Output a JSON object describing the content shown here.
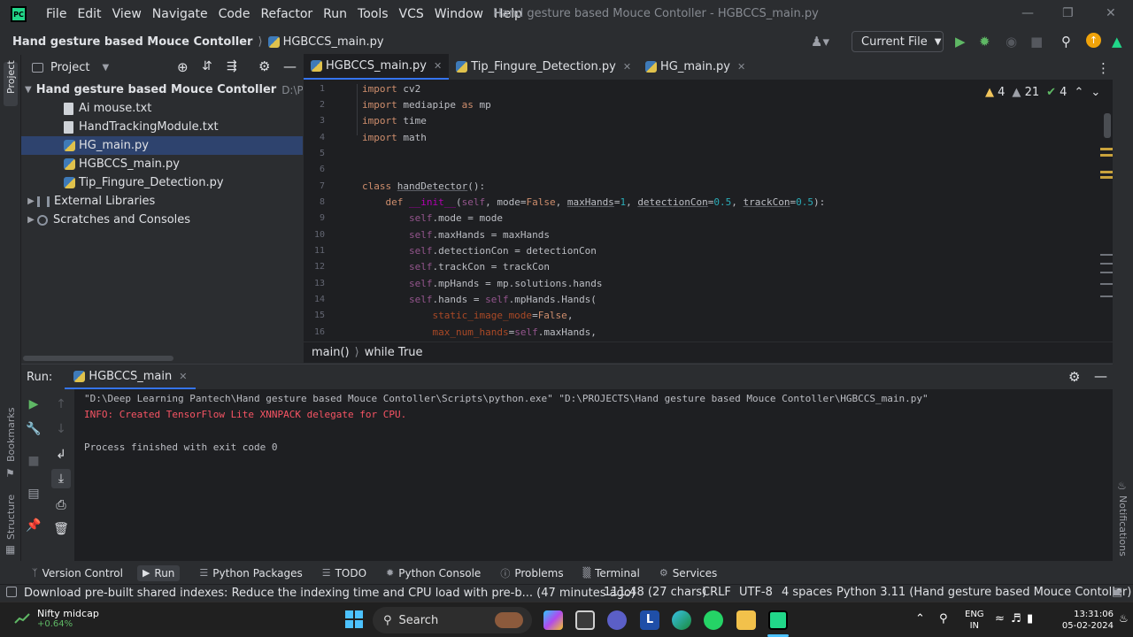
{
  "app": {
    "logo_text": "PC",
    "menu": [
      "File",
      "Edit",
      "View",
      "Navigate",
      "Code",
      "Refactor",
      "Run",
      "Tools",
      "VCS",
      "Window",
      "Help"
    ],
    "window_title": "Hand gesture based Mouce Contoller - HGBCCS_main.py"
  },
  "navbar": {
    "project": "Hand gesture based Mouce Contoller",
    "file": "HGBCCS_main.py",
    "run_config": "Current File"
  },
  "project_panel": {
    "title": "Project",
    "stripe_label": "Project",
    "root_name": "Hand gesture based Mouce Contoller",
    "root_path": "D:\\PRO",
    "files": [
      "Ai mouse.txt",
      "HandTrackingModule.txt",
      "HG_main.py",
      "HGBCCS_main.py",
      "Tip_Fingure_Detection.py"
    ],
    "external": "External Libraries",
    "scratches": "Scratches and Consoles"
  },
  "editor": {
    "tabs": [
      "HGBCCS_main.py",
      "Tip_Fingure_Detection.py",
      "HG_main.py"
    ],
    "line_numbers": [
      "1",
      "2",
      "3",
      "4",
      "5",
      "6",
      "7",
      "8",
      "9",
      "10",
      "11",
      "12",
      "13",
      "14",
      "15",
      "16"
    ],
    "inspections": {
      "warnings": "4",
      "weak_warnings": "21",
      "ok": "4"
    },
    "breadcrumb": [
      "main()",
      "while True"
    ]
  },
  "run_panel": {
    "label": "Run:",
    "tab": "HGBCCS_main",
    "console": [
      "\"D:\\Deep Learning Pantech\\Hand gesture based Mouce Contoller\\Scripts\\python.exe\" \"D:\\PROJECTS\\Hand gesture based Mouce Contoller\\HGBCCS_main.py\"",
      "INFO: Created TensorFlow Lite XNNPACK delegate for CPU.",
      "Process finished with exit code 0"
    ]
  },
  "stripes": {
    "bookmarks": "Bookmarks",
    "structure": "Structure",
    "notifications": "Notifications"
  },
  "tool_windows": [
    "Version Control",
    "Run",
    "Python Packages",
    "TODO",
    "Python Console",
    "Problems",
    "Terminal",
    "Services"
  ],
  "status": {
    "message": "Download pre-built shared indexes: Reduce the indexing time and CPU load with pre-b... (47 minutes ago)",
    "position": "111:48 (27 chars)",
    "line_sep": "CRLF",
    "encoding": "UTF-8",
    "indent": "4 spaces",
    "interpreter": "Python 3.11 (Hand gesture based Mouce Contoller)"
  },
  "taskbar": {
    "weather_title": "Nifty midcap",
    "weather_value": "+0.64%",
    "search": "Search",
    "lang_top": "ENG",
    "lang_bottom": "IN",
    "time": "13:31:06",
    "date": "05-02-2024"
  },
  "colors": {
    "accent": "#3574f0",
    "error_text": "#f75464",
    "selection": "#2e436e",
    "run_green": "#5fb865"
  }
}
